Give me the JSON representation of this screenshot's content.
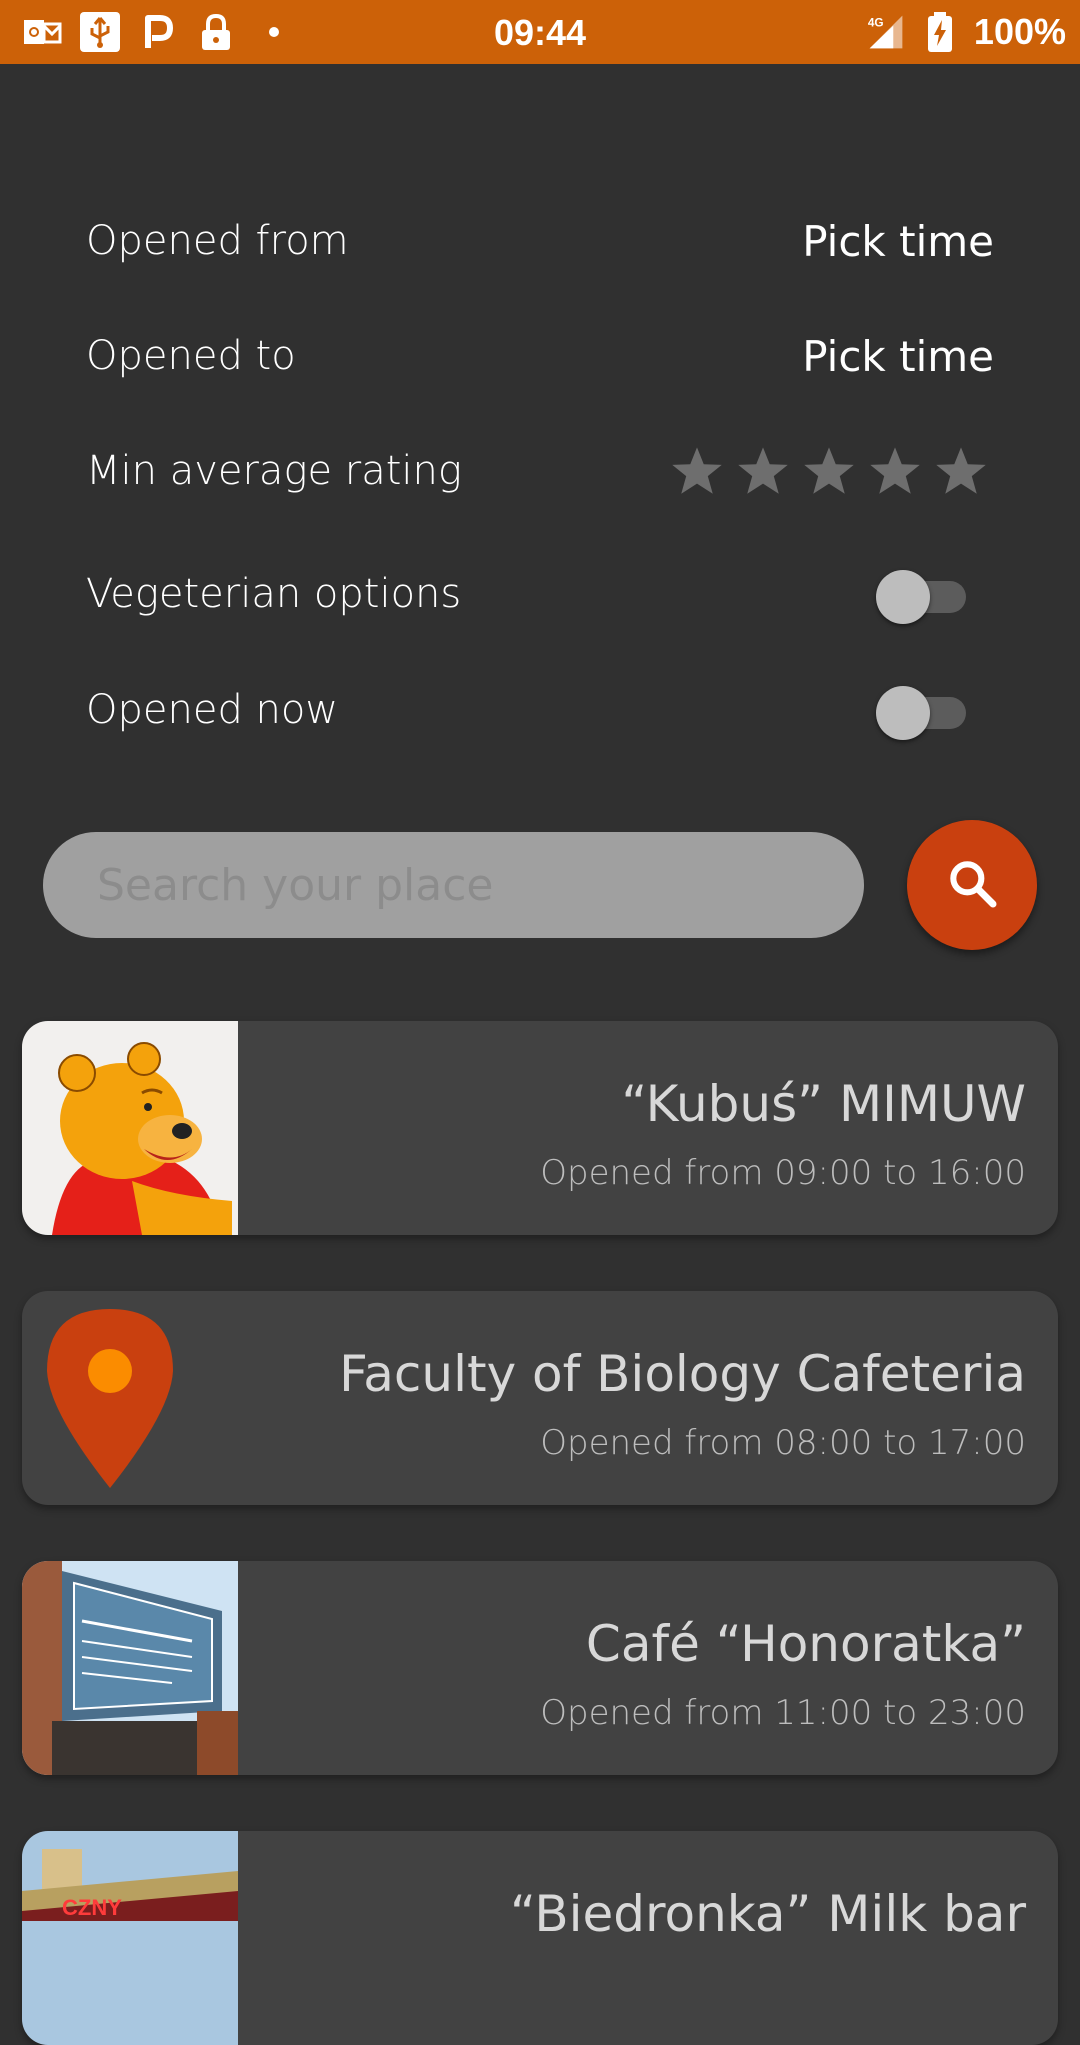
{
  "status_bar": {
    "time": "09:44",
    "battery": "100%",
    "network": "4G",
    "left_icons": [
      "outlook-icon",
      "usb-icon",
      "parking-icon",
      "lock-icon",
      "dot-icon"
    ]
  },
  "filters": {
    "opened_from": {
      "label": "Opened from",
      "value": "Pick time"
    },
    "opened_to": {
      "label": "Opened to",
      "value": "Pick time"
    },
    "min_rating": {
      "label": "Min average rating",
      "rating": 0,
      "max": 5
    },
    "vegetarian": {
      "label": "Vegeterian options",
      "on": false
    },
    "opened_now": {
      "label": "Opened now",
      "on": false
    }
  },
  "search": {
    "placeholder": "Search your place"
  },
  "places": [
    {
      "title": "“Kubuś” MIMUW",
      "hours": "Opened from 09:00 to 16:00",
      "thumb": "winnie-the-pooh-image"
    },
    {
      "title": "Faculty of Biology Cafeteria",
      "hours": "Opened from 08:00 to 17:00",
      "thumb": "map-pin-icon"
    },
    {
      "title": "Café “Honoratka”",
      "hours": "Opened from 11:00 to 23:00",
      "thumb": "cafe-sign-photo"
    },
    {
      "title": "“Biedronka” Milk bar",
      "hours": "",
      "thumb": "milk-bar-photo"
    }
  ],
  "colors": {
    "status_bar": "#cc6108",
    "background": "#303030",
    "card": "#424242",
    "accent": "#c9400f"
  }
}
